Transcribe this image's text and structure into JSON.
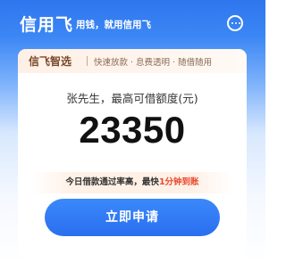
{
  "header": {
    "brand": "信用飞",
    "slogan": "用钱，就用信用飞",
    "menu_icon": "more-circle-icon"
  },
  "card": {
    "tagline_title": "信飞智选",
    "tagline_desc": "快速放款 · 息费透明 · 随借随用",
    "limit_label": "张先生，最高可借额度(元)",
    "limit_amount": "23350",
    "notice_prefix": "今日借款通过率高，最快",
    "notice_highlight": "1分钟到账",
    "apply_label": "立即申请"
  },
  "colors": {
    "brand_blue": "#2f76ee",
    "highlight_red": "#e84a2e",
    "tagline_brown": "#7a4a2a"
  }
}
